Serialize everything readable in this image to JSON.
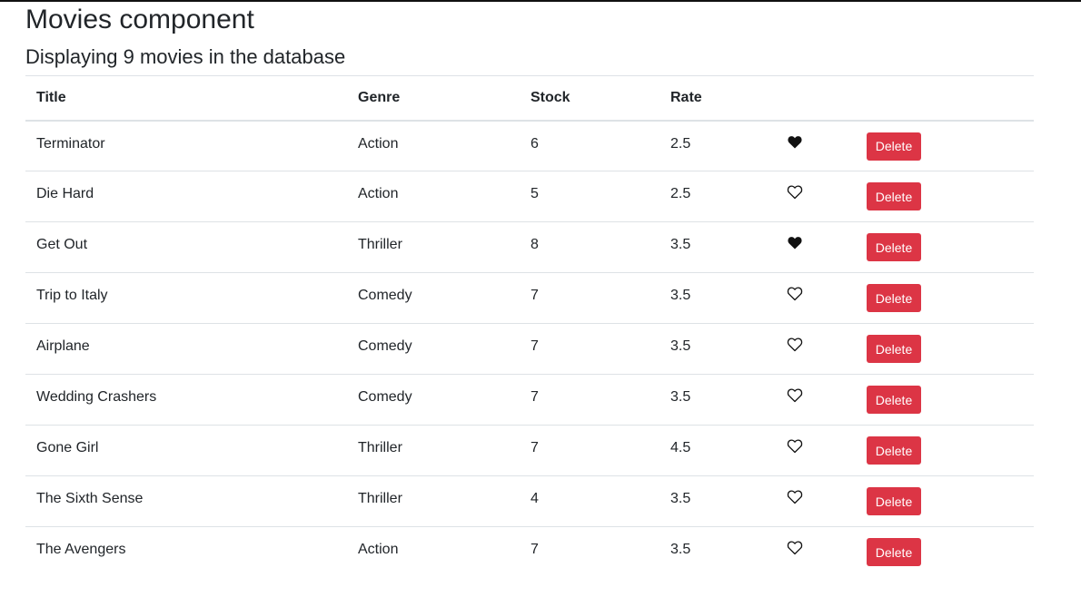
{
  "header": {
    "title": "Movies component",
    "subtitle": "Displaying 9 movies in the database"
  },
  "table": {
    "columns": [
      "Title",
      "Genre",
      "Stock",
      "Rate",
      "",
      ""
    ],
    "delete_label": "Delete",
    "rows": [
      {
        "title": "Terminator",
        "genre": "Action",
        "stock": "6",
        "rate": "2.5",
        "liked": true
      },
      {
        "title": "Die Hard",
        "genre": "Action",
        "stock": "5",
        "rate": "2.5",
        "liked": false
      },
      {
        "title": "Get Out",
        "genre": "Thriller",
        "stock": "8",
        "rate": "3.5",
        "liked": true
      },
      {
        "title": "Trip to Italy",
        "genre": "Comedy",
        "stock": "7",
        "rate": "3.5",
        "liked": false
      },
      {
        "title": "Airplane",
        "genre": "Comedy",
        "stock": "7",
        "rate": "3.5",
        "liked": false
      },
      {
        "title": "Wedding Crashers",
        "genre": "Comedy",
        "stock": "7",
        "rate": "3.5",
        "liked": false
      },
      {
        "title": "Gone Girl",
        "genre": "Thriller",
        "stock": "7",
        "rate": "4.5",
        "liked": false
      },
      {
        "title": "The Sixth Sense",
        "genre": "Thriller",
        "stock": "4",
        "rate": "3.5",
        "liked": false
      },
      {
        "title": "The Avengers",
        "genre": "Action",
        "stock": "7",
        "rate": "3.5",
        "liked": false
      }
    ]
  },
  "icons": {
    "like": "heart-icon"
  },
  "colors": {
    "danger": "#dc3545",
    "text": "#212529",
    "border": "#dee2e6"
  }
}
